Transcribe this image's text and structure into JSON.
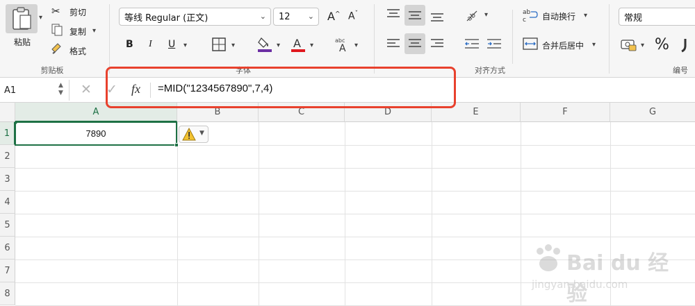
{
  "ribbon": {
    "clipboard": {
      "paste_label": "粘贴",
      "cut_label": "剪切",
      "copy_label": "复制",
      "format_label": "格式",
      "group_label": "剪贴板"
    },
    "font": {
      "font_name": "等线 Regular (正文)",
      "font_size": "12",
      "bold": "B",
      "italic": "I",
      "underline": "U",
      "fill_color": "#6b2fa3",
      "font_color": "#e0181e",
      "group_label": "字体"
    },
    "alignment": {
      "wrap_text_label": "自动换行",
      "merge_center_label": "合并后居中",
      "group_label": "对齐方式"
    },
    "number": {
      "format_value": "常规",
      "percent_symbol": "%",
      "group_label": "编号"
    }
  },
  "formula_bar": {
    "name_box": "A1",
    "fx_label": "fx",
    "formula": "=MID(\"1234567890\",7,4)"
  },
  "sheet": {
    "columns": [
      "A",
      "B",
      "C",
      "D",
      "E",
      "F",
      "G"
    ],
    "rows": [
      "1",
      "2",
      "3",
      "4",
      "5",
      "6",
      "7",
      "8"
    ],
    "cell_a1": "7890",
    "selected_cell": "A1",
    "accent": "#1e7145"
  },
  "highlight_color": "#e8412d",
  "watermark": {
    "brand": "Bai du 经验",
    "url": "jingyan.baidu.com"
  }
}
